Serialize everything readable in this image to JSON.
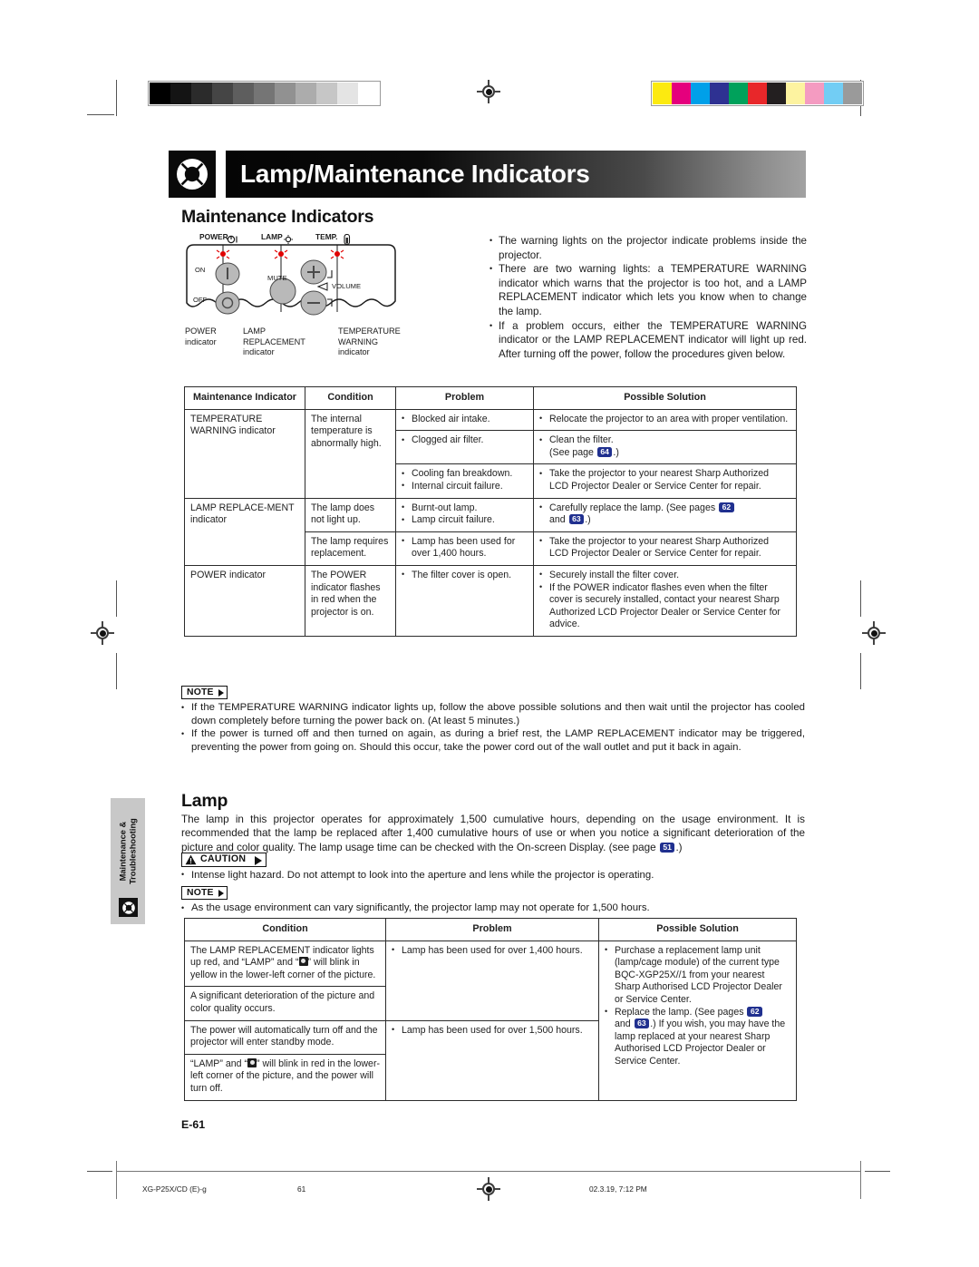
{
  "document": {
    "chapter_title": "Lamp/Maintenance Indicators",
    "chapter_icon": "lifebuoy-icon",
    "section_heading": "Maintenance Indicators",
    "lamp_heading": "Lamp",
    "folio": "E-61",
    "side_tab_label": "Maintenance &\nTroubleshooting"
  },
  "footer": {
    "file": "XG-P25X/CD (E)-g",
    "page": "61",
    "timestamp": "02.3.19, 7:12 PM"
  },
  "colorbars": {
    "gray": [
      "#000000",
      "#141414",
      "#2b2b2b",
      "#454545",
      "#5e5e5e",
      "#757575",
      "#919191",
      "#acacac",
      "#c6c6c6",
      "#e4e4e4",
      "#ffffff"
    ],
    "color": [
      "#fcea10",
      "#e5007d",
      "#00a0e9",
      "#2e3192",
      "#00a15b",
      "#e8272a",
      "#231f20",
      "#fdf3a0",
      "#f49bc1",
      "#72cdf4",
      "#9a9a9a"
    ]
  },
  "figure": {
    "labels": {
      "power": "POWER",
      "lamp": "LAMP",
      "temp": "TEMP.",
      "on": "ON",
      "off": "OFF",
      "mute": "MUTE",
      "volume": "VOLUME"
    },
    "captions": [
      {
        "line1": "POWER",
        "line2": "indicator",
        "line3": ""
      },
      {
        "line1": "LAMP",
        "line2": "REPLACEMENT",
        "line3": "indicator"
      },
      {
        "line1": "TEMPERATURE",
        "line2": "WARNING",
        "line3": "indicator"
      }
    ]
  },
  "intro_bullets": [
    "The warning lights on the projector indicate problems inside the projector.",
    "There are two warning lights: a TEMPERATURE WARNING indicator which warns that the projector is too hot, and a LAMP REPLACEMENT indicator which lets you know when to change the lamp.",
    "If a problem occurs, either the TEMPERATURE WARNING indicator or the LAMP REPLACEMENT indicator will light up red. After turning off the power, follow the procedures given below."
  ],
  "table1": {
    "headers": [
      "Maintenance Indicator",
      "Condition",
      "Problem",
      "Possible Solution"
    ],
    "rows": [
      {
        "indicator": "TEMPERATURE WARNING indicator",
        "condition": "The internal temperature is abnormally high.",
        "problem": [
          "Blocked air intake."
        ],
        "solution": [
          "Relocate the projector to an area with proper ventilation."
        ]
      },
      {
        "problem": [
          "Clogged air filter."
        ],
        "solution_pre": "Clean the filter.",
        "solution_page_text_a": "(See page ",
        "solution_page_num": "64",
        "solution_page_text_b": ".)"
      },
      {
        "problem": [
          "Cooling fan breakdown.",
          "Internal circuit failure."
        ],
        "solution": [
          "Take the projector to your nearest Sharp Authorized LCD Projector Dealer or Service Center for repair."
        ]
      },
      {
        "indicator": "LAMP REPLACE-MENT indicator",
        "condition": "The lamp does not light up.",
        "problem": [
          "Burnt-out lamp.",
          "Lamp circuit failure."
        ],
        "solution_pre": "Carefully replace the lamp. (See pages ",
        "page_a": "62",
        "solution_mid": " and ",
        "page_b": "63",
        "solution_post": ".)"
      },
      {
        "condition": "The lamp requires replacement.",
        "problem": [
          "Lamp has been used for over 1,400 hours."
        ],
        "solution": [
          "Take the projector to your nearest Sharp Authorized LCD Projector Dealer or Service Center for repair."
        ]
      },
      {
        "indicator": "POWER indicator",
        "condition": "The POWER indicator flashes in red when the projector is on.",
        "problem": [
          "The filter cover is open."
        ],
        "solution": [
          "Securely install the filter cover.",
          "If the POWER indicator flashes even when the filter cover is securely installed, contact your nearest Sharp Authorized LCD Projector Dealer or Service Center for advice."
        ]
      }
    ]
  },
  "note1": {
    "badge": "NOTE",
    "items": [
      "If the TEMPERATURE WARNING indicator lights up, follow the above possible solutions and then wait until the projector has cooled down completely before turning the power back on. (At least 5 minutes.)",
      "If the power is turned off and then turned on again, as during a brief rest, the LAMP REPLACEMENT indicator may be triggered, preventing the power from going on. Should this occur, take the power cord out of the wall outlet and put it back in again."
    ]
  },
  "lamp_body": {
    "text_a": "The lamp in this projector operates for approximately 1,500 cumulative hours, depending on the usage environment. It is recommended that the lamp be replaced after 1,400 cumulative hours of use or when you notice a significant deterioration of the picture and color quality. The lamp usage time can be checked with the On-screen Display. (see page ",
    "page": "51",
    "text_b": ".)"
  },
  "caution": {
    "badge": "CAUTION",
    "items": [
      "Intense light hazard. Do not attempt to look into the aperture and lens while the projector is operating."
    ]
  },
  "note2": {
    "badge": "NOTE",
    "items": [
      "As the usage environment can vary significantly, the projector lamp may not operate for 1,500 hours."
    ]
  },
  "table2": {
    "headers": [
      "Condition",
      "Problem",
      "Possible Solution"
    ],
    "rows": [
      {
        "condition_a": "The LAMP REPLACEMENT indicator lights up red, and “LAMP” and “",
        "condition_b": "” will blink in yellow in the lower-left corner of the picture.",
        "problem": [
          "Lamp has been used for over 1,400 hours."
        ]
      },
      {
        "condition": "A significant deterioration of the picture and color quality occurs."
      },
      {
        "condition": "The power will automatically turn off and the projector will enter standby mode.",
        "problem": [
          "Lamp has been used for over 1,500 hours."
        ]
      },
      {
        "condition_a": "“LAMP” and “",
        "condition_b": "” will blink in red in the lower-left corner of the picture, and the power will turn off."
      }
    ],
    "solution": {
      "item1": "Purchase a replacement lamp unit (lamp/cage module) of the current type BQC-XGP25X//1 from your nearest Sharp Authorised LCD Projector Dealer or Service Center.",
      "item2_a": "Replace the lamp. (See pages ",
      "item2_page_a": "62",
      "item2_mid": " and ",
      "item2_page_b": "63",
      "item2_b": ".) If you wish, you may have the lamp replaced at your nearest Sharp Authorised LCD Projector Dealer or Service Center."
    }
  }
}
